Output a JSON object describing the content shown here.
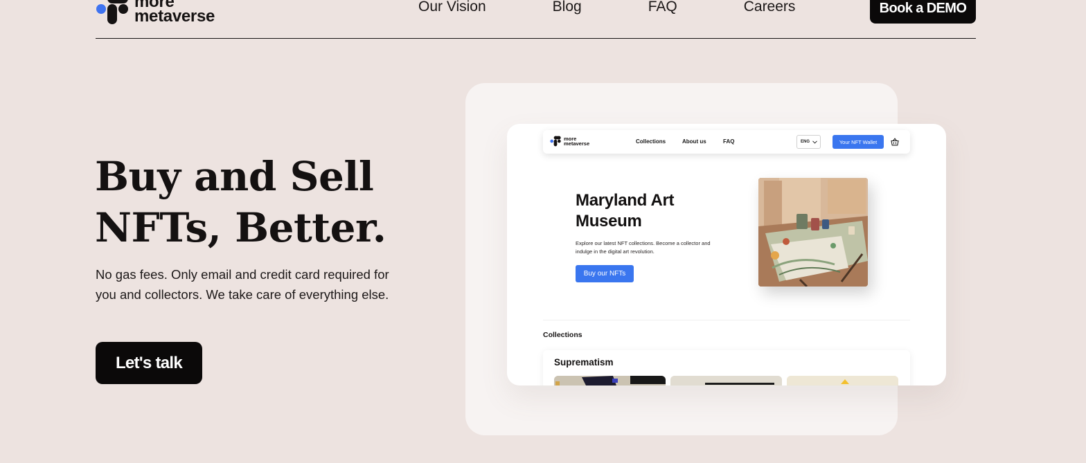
{
  "header": {
    "brand": {
      "line1": "more",
      "line2": "metaverse"
    },
    "nav": [
      "Our Vision",
      "Blog",
      "FAQ",
      "Careers"
    ],
    "cta_label": "Book a DEMO"
  },
  "hero": {
    "title_line1": "Buy and Sell",
    "title_line2": "NFTs, Better.",
    "description": "No gas fees. Only email and credit card required for you and collectors. We take care of everything else.",
    "cta_label": "Let's talk"
  },
  "mockup": {
    "brand": {
      "line1": "more",
      "line2": "metaverse"
    },
    "nav": [
      "Collections",
      "About us",
      "FAQ"
    ],
    "language": "ENG",
    "wallet_label": "Your NFT Wallet",
    "museum_title_line1": "Maryland Art",
    "museum_title_line2": "Museum",
    "museum_desc": "Explore our latest NFT collections. Become a collector and indulge in the digital art revolution.",
    "buy_label": "Buy our NFTs",
    "collections_label": "Collections",
    "collection_name": "Suprematism"
  },
  "colors": {
    "page_bg": "#ede3e0",
    "dark": "#0b0909",
    "accent_blue": "#3a76ef",
    "panel_bg": "#f7f3f2"
  },
  "icons": {
    "logo": "dots-logo-icon",
    "chevron": "chevron-down-icon",
    "basket": "basket-icon"
  }
}
